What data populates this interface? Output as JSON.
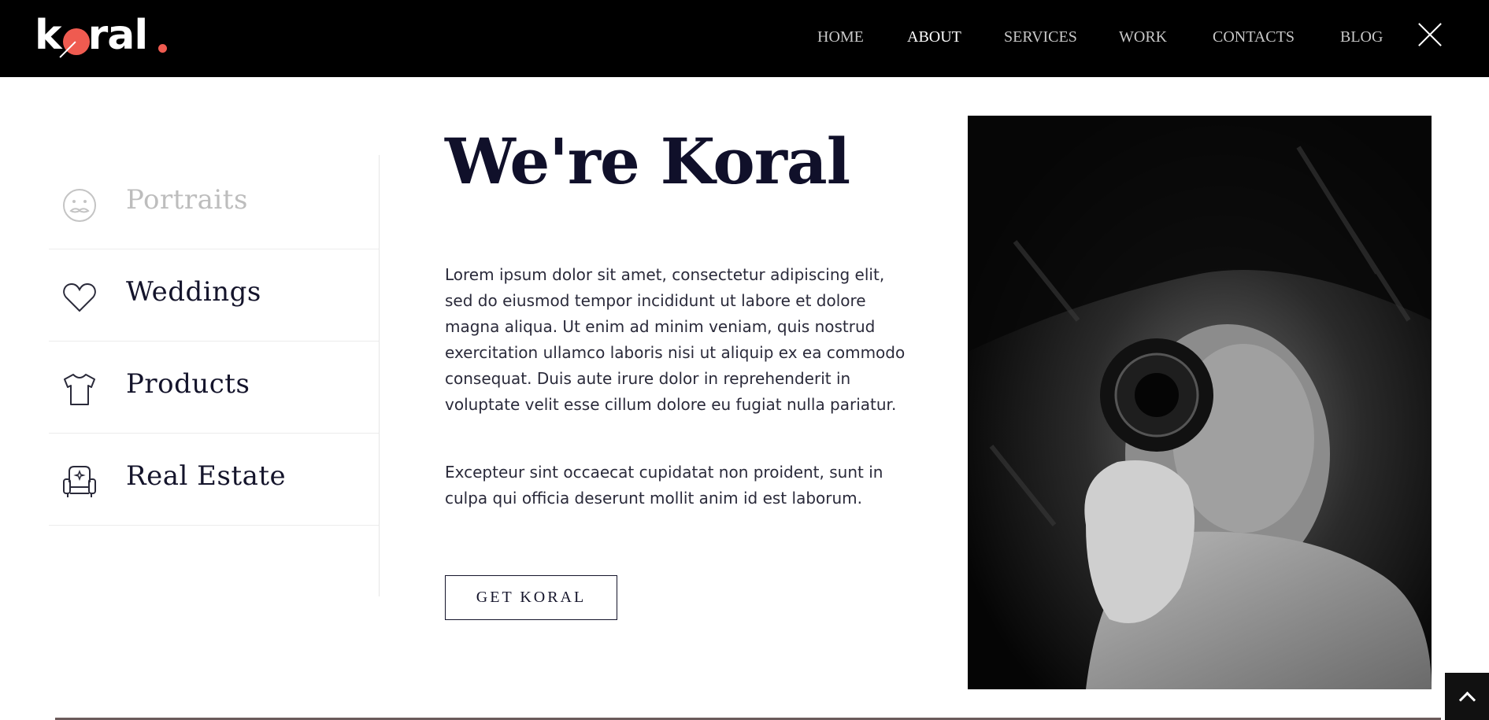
{
  "header": {
    "logo_text": "k ral",
    "nav": [
      {
        "label": "HOME",
        "active": false
      },
      {
        "label": "ABOUT",
        "active": true
      },
      {
        "label": "SERVICES",
        "active": false
      },
      {
        "label": "WORK",
        "active": false
      },
      {
        "label": "CONTACTS",
        "active": false
      },
      {
        "label": "BLOG",
        "active": false
      }
    ],
    "close_icon": "close-icon"
  },
  "services": [
    {
      "label": "Portraits",
      "icon": "mustache-face-icon",
      "muted": true
    },
    {
      "label": "Weddings",
      "icon": "heart-icon",
      "muted": false
    },
    {
      "label": "Products",
      "icon": "tshirt-icon",
      "muted": false
    },
    {
      "label": "Real Estate",
      "icon": "armchair-icon",
      "muted": false
    }
  ],
  "main": {
    "title": "We're Koral",
    "paragraph_1": "Lorem ipsum dolor sit amet, consectetur adipiscing elit, sed do eiusmod tempor incididunt ut labore et dolore magna aliqua. Ut enim ad minim veniam, quis nostrud exercitation ullamco laboris nisi ut aliquip ex ea commodo consequat. Duis aute irure dolor in reprehenderit in voluptate velit esse cillum dolore eu fugiat nulla pariatur.",
    "paragraph_2": "Excepteur sint occaecat cupidatat non proident, sunt in culpa qui officia deserunt mollit anim id est laborum.",
    "cta_label": "GET KORAL"
  },
  "photo": {
    "alt": "black-and-white photographer with camera"
  },
  "colors": {
    "accent": "#ef5b50",
    "header_bg": "#000000",
    "text_dark": "#14142b"
  }
}
